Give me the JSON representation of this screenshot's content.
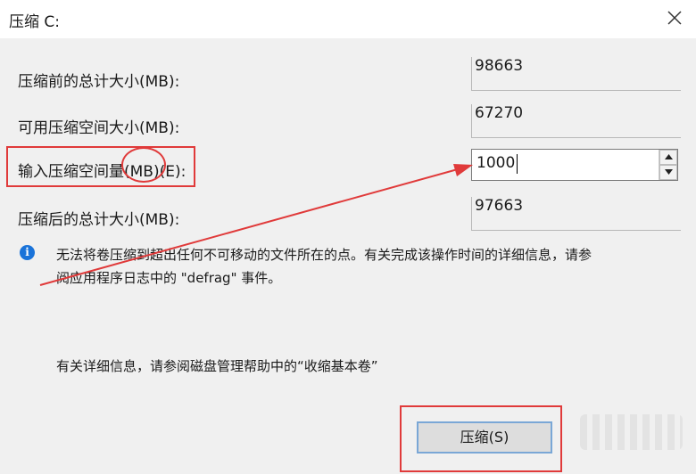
{
  "window": {
    "title": "压缩 C:",
    "close_label": "×"
  },
  "fields": [
    {
      "label": "压缩前的总计大小(MB):",
      "value": "98663"
    },
    {
      "label": "可用压缩空间大小(MB):",
      "value": "67270"
    },
    {
      "label": "输入压缩空间量(MB)(E):",
      "value": "1000"
    },
    {
      "label": "压缩后的总计大小(MB):",
      "value": "97663"
    }
  ],
  "info_message": {
    "line1": "无法将卷压缩到超出任何不可移动的文件所在的点。有关完成该操作时间的详细信息，请参",
    "line2": "阅应用程序日志中的 \"defrag\" 事件。"
  },
  "help_note": "有关详细信息，请参阅磁盘管理帮助中的“收缩基本卷”",
  "shrink_button": "压缩(S)",
  "annotation_color": "#e03a3a"
}
